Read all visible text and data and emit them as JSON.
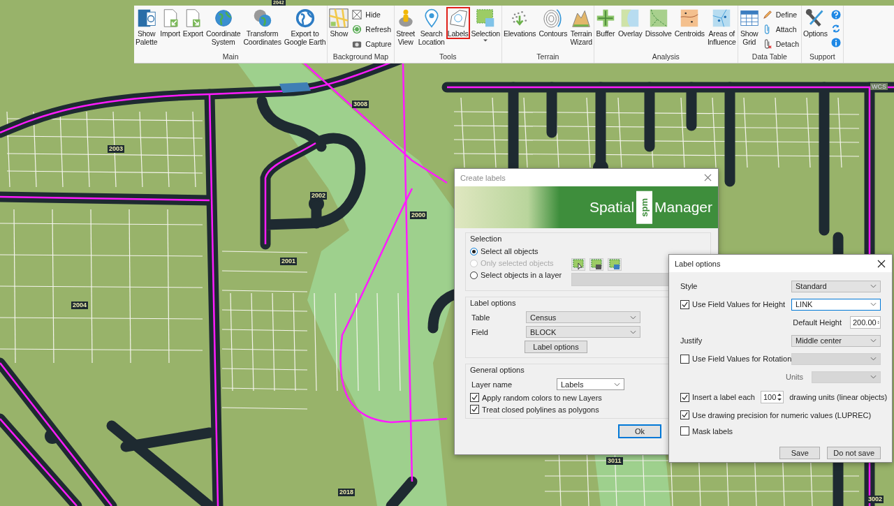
{
  "ribbon": {
    "groups": [
      {
        "label": "Main",
        "buttons": [
          {
            "kind": "large",
            "lines": [
              "Show",
              "Palette"
            ],
            "selected": false
          },
          {
            "kind": "large",
            "lines": [
              "Import"
            ],
            "selected": false
          },
          {
            "kind": "large",
            "lines": [
              "Export"
            ],
            "selected": false
          },
          {
            "kind": "large",
            "lines": [
              "Coordinate",
              "System"
            ],
            "selected": false
          },
          {
            "kind": "large",
            "lines": [
              "Transform",
              "Coordinates"
            ],
            "selected": false
          },
          {
            "kind": "large",
            "lines": [
              "Export to",
              "Google Earth"
            ],
            "selected": false
          }
        ]
      },
      {
        "label": "Background Map",
        "buttons": [
          {
            "kind": "large",
            "lines": [
              "Show"
            ],
            "selected": false
          },
          {
            "kind": "small",
            "lines": [
              "Hide"
            ],
            "selected": false
          },
          {
            "kind": "small",
            "lines": [
              "Refresh"
            ],
            "selected": false
          },
          {
            "kind": "small",
            "lines": [
              "Capture"
            ],
            "selected": false
          }
        ]
      },
      {
        "label": "Tools",
        "buttons": [
          {
            "kind": "large",
            "lines": [
              "Street",
              "View"
            ],
            "selected": false
          },
          {
            "kind": "large",
            "lines": [
              "Search",
              "Location"
            ],
            "selected": false
          },
          {
            "kind": "large",
            "lines": [
              "Labels"
            ],
            "selected": true
          },
          {
            "kind": "menu",
            "lines": [
              "Selection"
            ],
            "selected": false
          }
        ]
      },
      {
        "label": "Terrain",
        "buttons": [
          {
            "kind": "large",
            "lines": [
              "Elevations"
            ],
            "selected": false
          },
          {
            "kind": "large",
            "lines": [
              "Contours"
            ],
            "selected": false
          },
          {
            "kind": "large",
            "lines": [
              "Terrain",
              "Wizard"
            ],
            "selected": false
          }
        ]
      },
      {
        "label": "Analysis",
        "buttons": [
          {
            "kind": "large",
            "lines": [
              "Buffer"
            ],
            "selected": false
          },
          {
            "kind": "large",
            "lines": [
              "Overlay"
            ],
            "selected": false
          },
          {
            "kind": "large",
            "lines": [
              "Dissolve"
            ],
            "selected": false
          },
          {
            "kind": "large",
            "lines": [
              "Centroids"
            ],
            "selected": false
          },
          {
            "kind": "large",
            "lines": [
              "Areas of",
              "Influence"
            ],
            "selected": false
          }
        ]
      },
      {
        "label": "Data Table",
        "buttons": [
          {
            "kind": "large",
            "lines": [
              "Show",
              "Grid"
            ],
            "selected": false
          },
          {
            "kind": "small",
            "lines": [
              "Define"
            ],
            "selected": false
          },
          {
            "kind": "small",
            "lines": [
              "Attach"
            ],
            "selected": false
          },
          {
            "kind": "small",
            "lines": [
              "Detach"
            ],
            "selected": false
          }
        ]
      },
      {
        "label": "Support",
        "buttons": [
          {
            "kind": "large",
            "lines": [
              "Options"
            ],
            "selected": false
          },
          {
            "kind": "icon",
            "selected": false
          },
          {
            "kind": "icon",
            "selected": false
          },
          {
            "kind": "icon",
            "selected": false
          }
        ]
      }
    ]
  },
  "map": {
    "labels": [
      {
        "text": "2042"
      },
      {
        "text": "3008"
      },
      {
        "text": "2003"
      },
      {
        "text": "2002"
      },
      {
        "text": "2000"
      },
      {
        "text": "2001"
      },
      {
        "text": "2004"
      },
      {
        "text": "3011"
      },
      {
        "text": "2018"
      },
      {
        "text": "3002"
      }
    ],
    "crs_label": "WCS"
  },
  "create_labels": {
    "title": "Create labels",
    "banner": {
      "brand_left": "Spatial",
      "brand_mark": "spm",
      "brand_right": "Manager"
    },
    "selection": {
      "title": "Selection",
      "options": [
        {
          "label": "Select all objects",
          "selected": true,
          "disabled": false
        },
        {
          "label": "Only selected objects",
          "selected": false,
          "disabled": true
        },
        {
          "label": "Select objects in a layer",
          "selected": false,
          "disabled": false
        }
      ]
    },
    "label_options": {
      "title": "Label options",
      "fields": [
        {
          "label": "Table",
          "value": "Census"
        },
        {
          "label": "Field",
          "value": "BLOCK"
        }
      ],
      "button": "Label options"
    },
    "general": {
      "title": "General options",
      "layer_label": "Layer name",
      "layer_value": "Labels",
      "checks": [
        {
          "label": "Apply random colors to new Layers",
          "checked": true
        },
        {
          "label": "Treat closed polylines as polygons",
          "checked": true
        }
      ]
    },
    "ok_button": "Ok"
  },
  "label_options": {
    "title": "Label options",
    "style": {
      "label": "Style",
      "value": "Standard"
    },
    "height": {
      "label": "Use Field Values for Height",
      "checked": true,
      "value": "LINK",
      "default_label": "Default Height",
      "default_value": "200.00"
    },
    "justify": {
      "label": "Justify",
      "value": "Middle center"
    },
    "rotation": {
      "label": "Use Field Values for Rotation",
      "checked": false,
      "units_label": "Units"
    },
    "insert": {
      "label": "Insert a label each",
      "checked": true,
      "value": "100",
      "suffix": "drawing units (linear objects)"
    },
    "precision": {
      "label": "Use drawing precision for numeric values (LUPREC)",
      "checked": true
    },
    "mask": {
      "label": "Mask labels",
      "checked": false
    },
    "buttons": [
      "Save",
      "Do not save"
    ]
  }
}
